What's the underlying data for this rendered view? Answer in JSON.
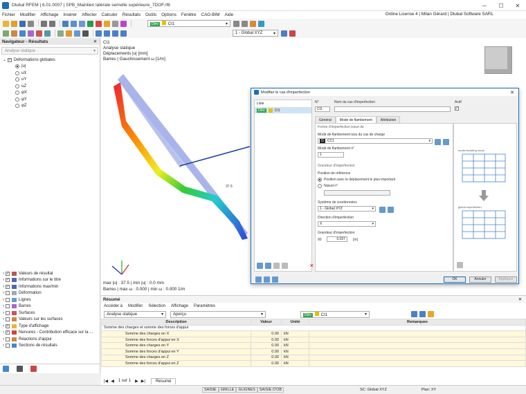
{
  "titlebar": {
    "title": "Dlubal RFEM | 6.01.0007 | SPB_Maintien latérale semelle supérieure_7DOF.rf6"
  },
  "menu": {
    "items": [
      "Fichier",
      "Modifier",
      "Affichage",
      "Insérer",
      "Affecter",
      "Calculer",
      "Résultats",
      "Outils",
      "Options",
      "Fenêtre",
      "CAO-BIM",
      "Aide"
    ],
    "license": "Online License 4 | Milan Gérard | Dlubal Software SARL"
  },
  "toolbar": {
    "dev_tag": "Dév",
    "case": "CI1",
    "coord_system": "1 - Global XYZ"
  },
  "navigator": {
    "title": "Navigateur - Résultats",
    "select": "Analyse statique",
    "deformations": {
      "label": "Déformations globales",
      "items": [
        "|u|",
        "uX",
        "uY",
        "uZ",
        "φX",
        "φY",
        "φZ"
      ]
    },
    "bottom_items": [
      "Valeurs de résultat",
      "Informations sur le titre",
      "Informations max/min",
      "Déformation",
      "Lignes",
      "Barres",
      "Surfaces",
      "Valeurs sur les surfaces",
      "Type d'affichage",
      "Nervures - Contribution efficace sur la ...",
      "Réactions d'appui",
      "Sections de résultats"
    ]
  },
  "viewport": {
    "lines": [
      "CI1",
      "Analyse statique",
      "Déplacements |u| [mm]",
      "Barres | Gauchissement ω [1/m]"
    ],
    "value_label": "37.5",
    "footer": [
      "max |u| : 37.5 | min |u| : 0.0 mm",
      "Barres | max ω : 0.000 | min ω : 0.000 1/m"
    ]
  },
  "dialog": {
    "title": "Modifier le cas d'imperfection",
    "list_header": "Liste",
    "list_item_dev": "Dév",
    "list_item": "CI1",
    "no_label": "N°",
    "no_value": "CI1",
    "name_label": "Nom du cas d'imperfection",
    "active_label": "Actif",
    "tabs": [
      "Général",
      "Mode de flambement",
      "Attribution"
    ],
    "section1": "Forme d'imperfection issue de",
    "mode_label": "Mode de flambement issu du cas de charge",
    "mode_tag": "G",
    "mode_value": "CC1",
    "mode_no_label": "Mode de flambement n°",
    "mode_no_value": "1",
    "section2": "Grandeur d'imperfection",
    "ref_label": "Position de référence",
    "radio1": "Position avec le déplacement le plus important",
    "radio2": "Nœud n°",
    "coord_label": "Système de coordonnées",
    "coord_value": "1 - Global XYZ",
    "dir_label": "Direction d'imperfection",
    "dir_value": "X",
    "mag_label": "Grandeur d'imperfection",
    "mag_symbol": "δ0",
    "mag_value": "0.037",
    "mag_unit": "[m]",
    "preview_top": "model buckling mode",
    "preview_bottom": "global imperfection",
    "ok": "OK",
    "cancel": "Annuler",
    "apply": "Appliquer"
  },
  "summary": {
    "title": "Résumé",
    "menu": [
      "Accéder à",
      "Modifier",
      "Sélection",
      "Affichage",
      "Paramètres"
    ],
    "select1": "Analyse statique",
    "select2": "Aperçu",
    "columns": [
      "Description",
      "Valeur",
      "Unité",
      "Remarques"
    ],
    "group": "Somme des charges et somme des forces d'appui",
    "rows": [
      [
        "Somme des charges en X",
        "0.00",
        "kN"
      ],
      [
        "Somme des forces d'appui en X",
        "0.00",
        "kN"
      ],
      [
        "Somme des charges en Y",
        "0.00",
        "kN"
      ],
      [
        "Somme des forces d'appui en Y",
        "0.00",
        "kN"
      ],
      [
        "Somme des charges en Z",
        "0.00",
        "kN"
      ],
      [
        "Somme des forces d'appui en Z",
        "0.00",
        "kN"
      ]
    ],
    "pager": "1 sur 1",
    "tab": "Résumé"
  },
  "statusbar": {
    "items": [
      "SAISIE",
      "GRILLE",
      "GLIGNES",
      "SAISIE D'OB"
    ],
    "cs": "SC: Global XYZ",
    "plane": "Plan: XY"
  }
}
